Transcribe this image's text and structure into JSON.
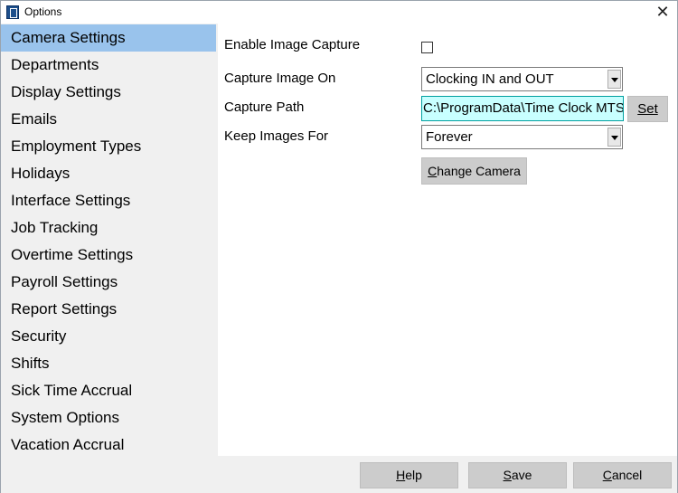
{
  "window": {
    "title": "Options",
    "close_glyph": "✕"
  },
  "sidebar": {
    "items": [
      {
        "label": "Camera Settings",
        "selected": true
      },
      {
        "label": "Departments"
      },
      {
        "label": "Display Settings"
      },
      {
        "label": "Emails"
      },
      {
        "label": "Employment Types"
      },
      {
        "label": "Holidays"
      },
      {
        "label": "Interface Settings"
      },
      {
        "label": "Job Tracking"
      },
      {
        "label": "Overtime Settings"
      },
      {
        "label": "Payroll Settings"
      },
      {
        "label": "Report Settings"
      },
      {
        "label": "Security"
      },
      {
        "label": "Shifts"
      },
      {
        "label": "Sick Time Accrual"
      },
      {
        "label": "System Options"
      },
      {
        "label": "Vacation Accrual"
      }
    ],
    "selected_color": "#99c3ec"
  },
  "camera": {
    "enable_label": "Enable Image Capture",
    "enable_checked": false,
    "capture_on_label": "Capture Image On",
    "capture_on_value": "Clocking IN and OUT",
    "path_label": "Capture Path",
    "path_value": "C:\\ProgramData\\Time Clock MTS",
    "set_label": "Set",
    "keep_label": "Keep Images For",
    "keep_value": "Forever",
    "change_camera_label": "Change Camera"
  },
  "footer": {
    "help_label": "Help",
    "save_label": "Save",
    "cancel_label": "Cancel"
  }
}
